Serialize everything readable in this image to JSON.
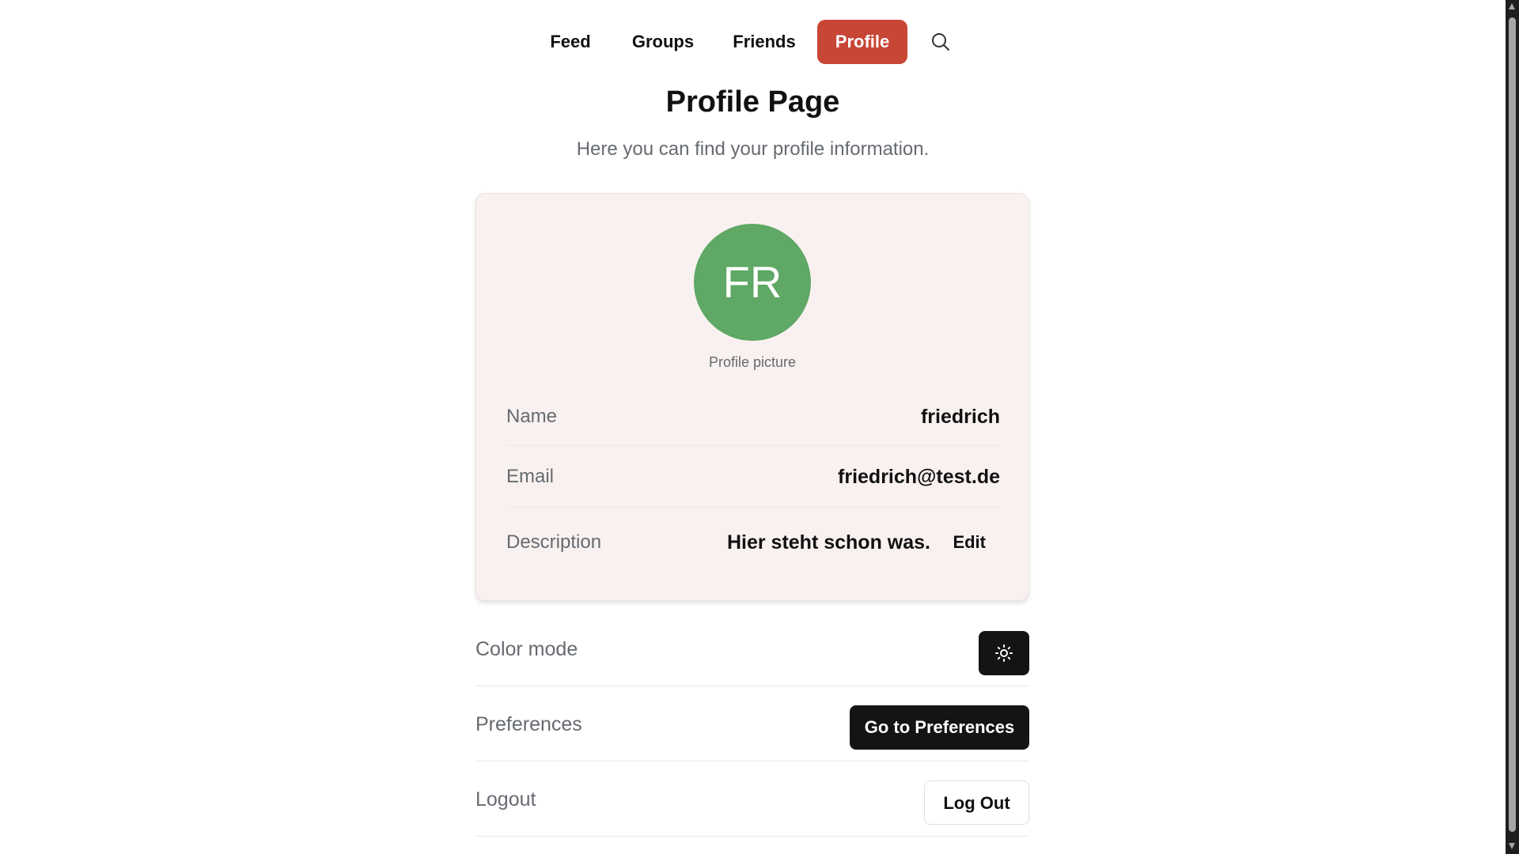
{
  "nav": {
    "items": [
      {
        "label": "Feed",
        "active": false
      },
      {
        "label": "Groups",
        "active": false
      },
      {
        "label": "Friends",
        "active": false
      },
      {
        "label": "Profile",
        "active": true
      }
    ],
    "search_icon": "search-icon"
  },
  "page": {
    "title": "Profile Page",
    "subtitle": "Here you can find your profile information."
  },
  "profile": {
    "avatar_initials": "FR",
    "avatar_color": "#5fa865",
    "avatar_caption": "Profile picture",
    "fields": [
      {
        "label": "Name",
        "value": "friedrich"
      },
      {
        "label": "Email",
        "value": "friedrich@test.de"
      },
      {
        "label": "Description",
        "value": "Hier steht schon was.",
        "action": "Edit"
      }
    ]
  },
  "settings": {
    "color_mode": {
      "label": "Color mode",
      "icon": "sun-icon"
    },
    "preferences": {
      "label": "Preferences",
      "button": "Go to Preferences"
    },
    "logout": {
      "label": "Logout",
      "button": "Log Out"
    }
  },
  "colors": {
    "accent": "#c84636",
    "card_background": "#f9f1f0",
    "dark_button": "#141414"
  }
}
